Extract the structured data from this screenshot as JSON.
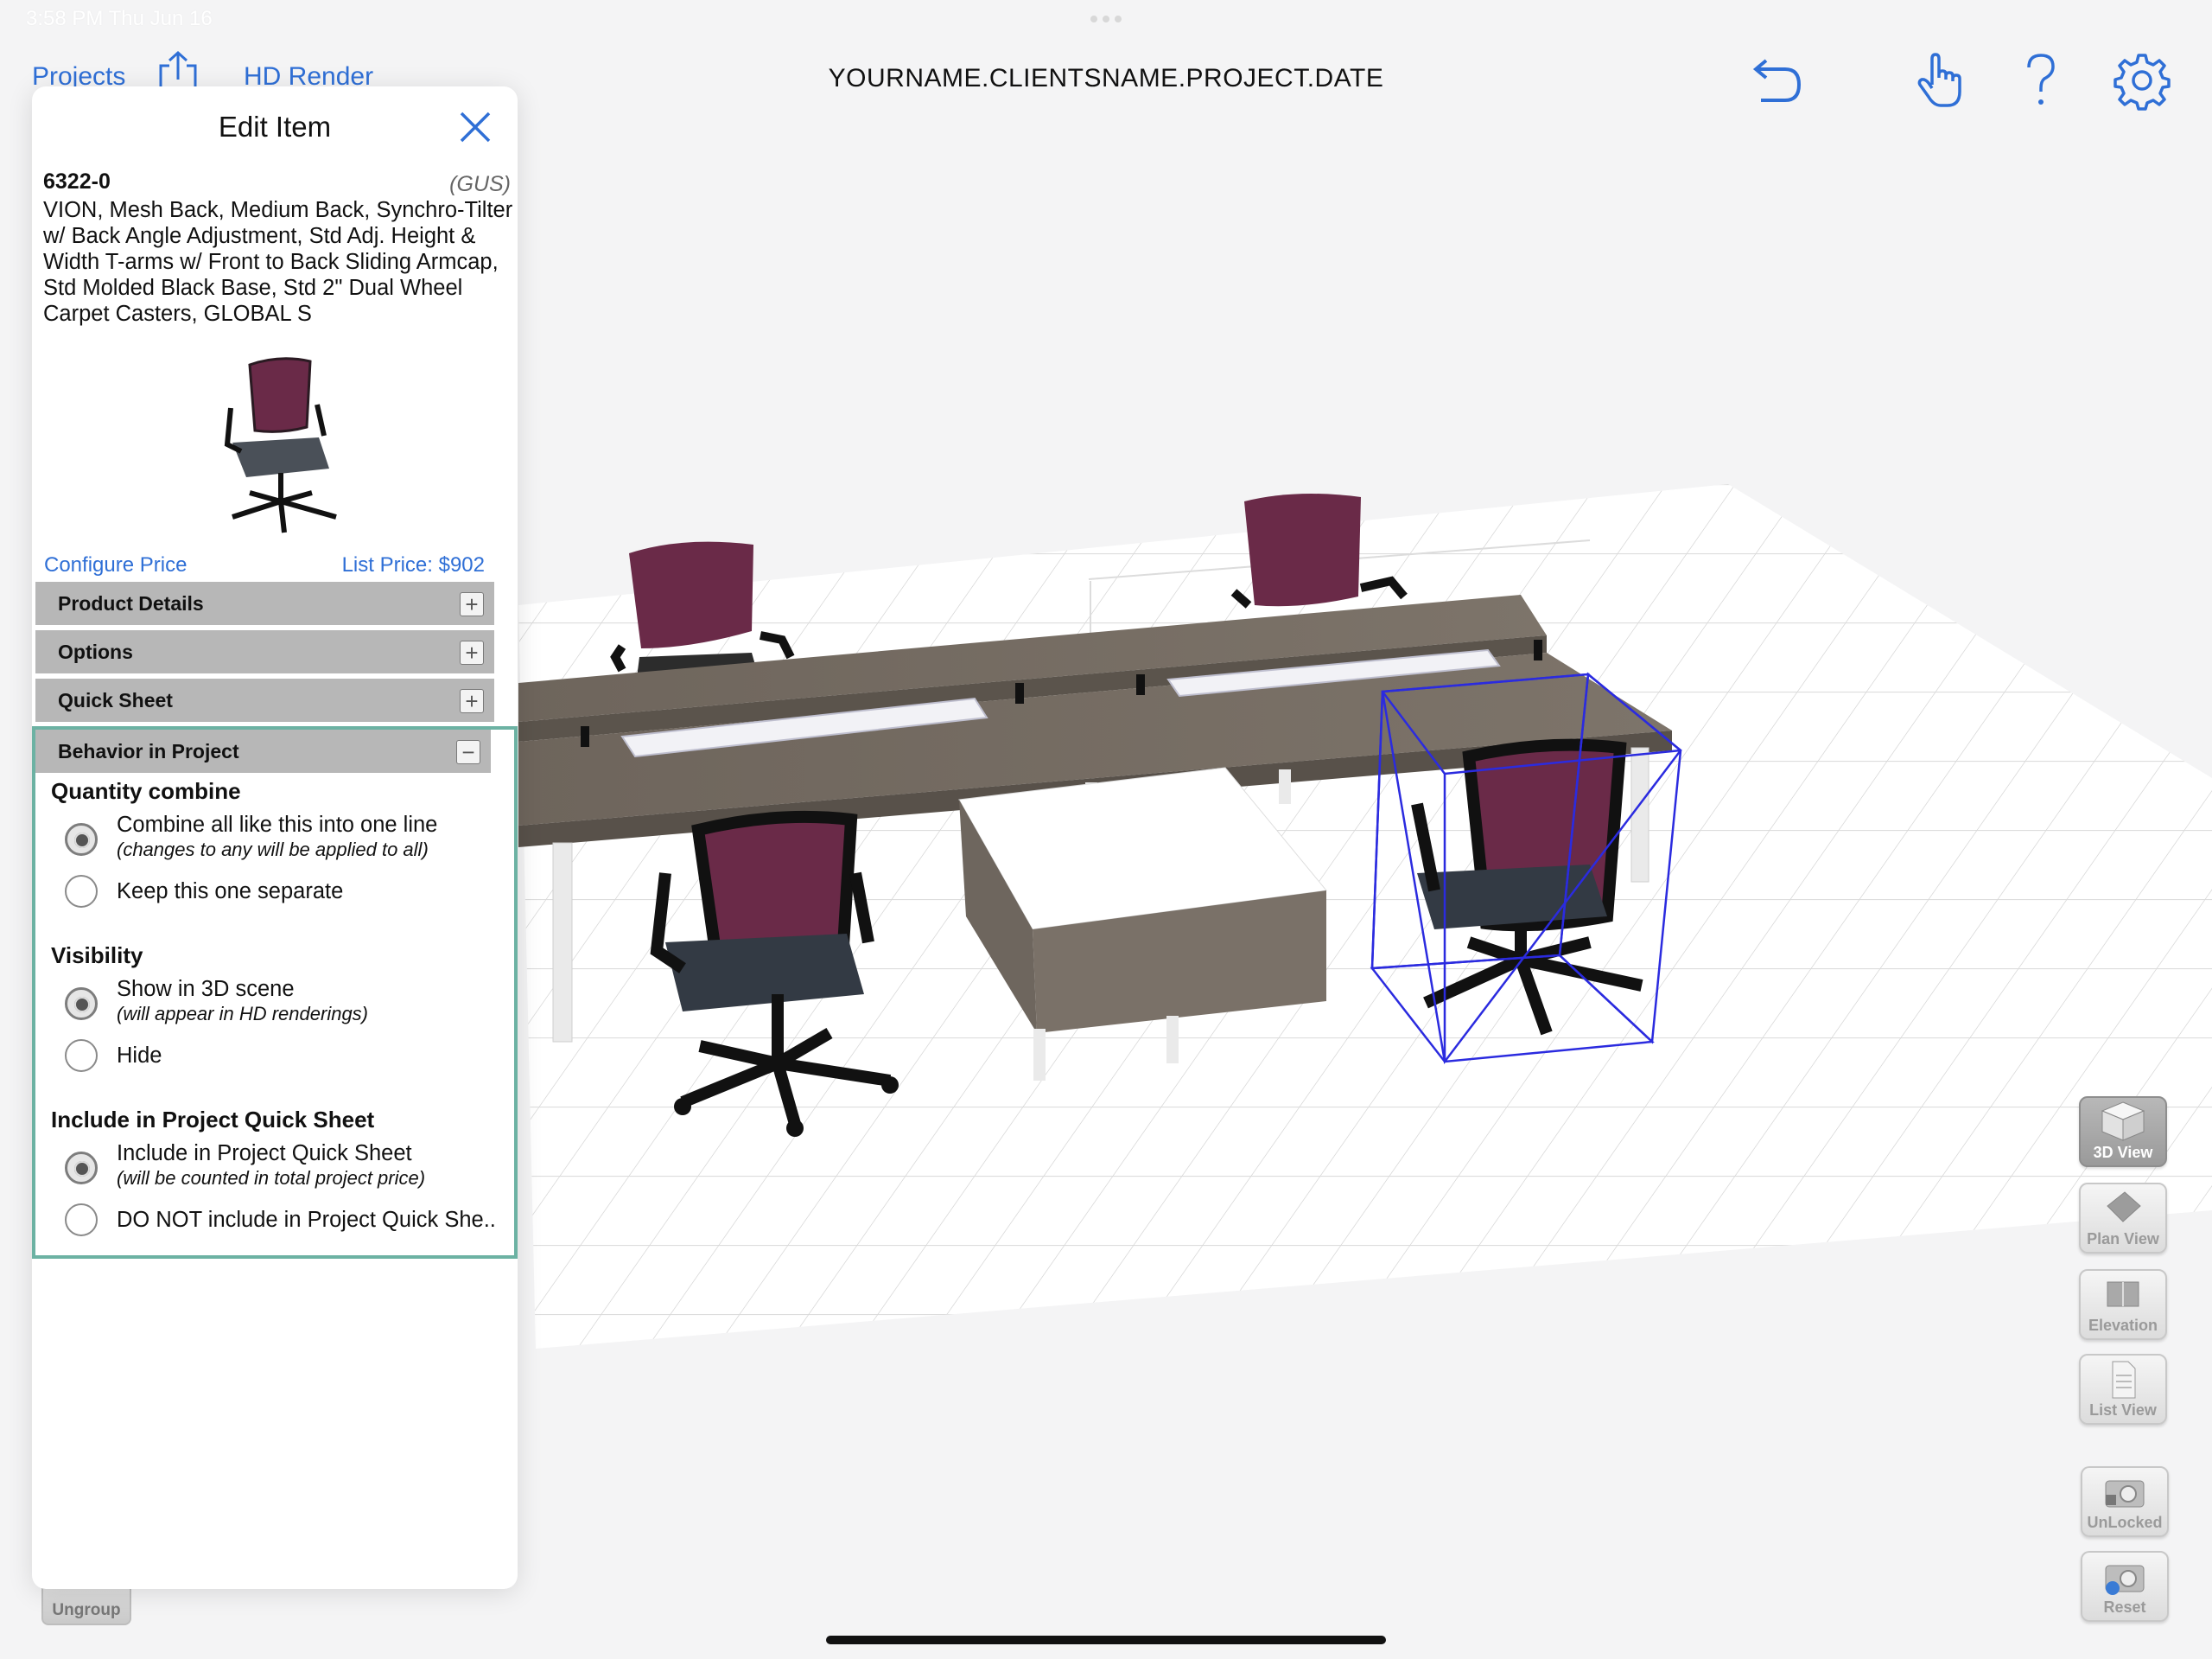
{
  "status": {
    "time": "3:58 PM  Thu Jun 16"
  },
  "topbar": {
    "projects_label": "Projects",
    "hd_render_label": "HD Render",
    "project_title": "YOURNAME.CLIENTSNAME.PROJECT.DATE",
    "icons": [
      "undo-icon",
      "hand-pointer-icon",
      "help-icon",
      "gear-icon"
    ],
    "accent_color": "#2f6fd6"
  },
  "edit_panel": {
    "title": "Edit Item",
    "sku": "6322-0",
    "brand": "(GUS)",
    "description": "VION, Mesh Back, Medium Back, Synchro-Tilter w/ Back Angle Adjustment, Std Adj. Height & Width T-arms w/ Front to Back Sliding Armcap, Std Molded Black Base, Std 2\" Dual Wheel Carpet Casters, GLOBAL S",
    "configure_price": "Configure Price",
    "list_price": "List Price: $902",
    "sections": [
      {
        "label": "Product Details",
        "toggle": "+"
      },
      {
        "label": "Options",
        "toggle": "+"
      },
      {
        "label": "Quick Sheet",
        "toggle": "+"
      },
      {
        "label": "Behavior in Project",
        "toggle": "−"
      }
    ],
    "behavior": {
      "quantity_heading": "Quantity combine",
      "quantity_options": [
        {
          "label": "Combine all like this into one line",
          "sub": "(changes to any will be applied to all)",
          "selected": true
        },
        {
          "label": "Keep this one separate",
          "sub": "",
          "selected": false
        }
      ],
      "visibility_heading": "Visibility",
      "visibility_options": [
        {
          "label": "Show in 3D scene",
          "sub": "(will appear in HD renderings)",
          "selected": true
        },
        {
          "label": "Hide",
          "sub": "",
          "selected": false
        }
      ],
      "quicksheet_heading": "Include in Project Quick Sheet",
      "quicksheet_options": [
        {
          "label": "Include in Project Quick Sheet",
          "sub": "(will be counted in total project price)",
          "selected": true
        },
        {
          "label": "DO NOT include in Project Quick She..",
          "sub": "",
          "selected": false
        }
      ],
      "highlight_color": "#6cb2a3"
    }
  },
  "view_toolbar": {
    "buttons": [
      {
        "label": "3D View",
        "icon": "cube-icon",
        "active": true
      },
      {
        "label": "Plan View",
        "icon": "plan-icon",
        "active": false
      },
      {
        "label": "Elevation",
        "icon": "elevation-icon",
        "active": false
      },
      {
        "label": "List View",
        "icon": "document-icon",
        "active": false
      },
      {
        "label": "UnLocked",
        "icon": "camera-unlocked-icon",
        "active": false
      },
      {
        "label": "Reset",
        "icon": "camera-reset-icon",
        "active": false
      }
    ]
  },
  "ungroup_label": "Ungroup"
}
